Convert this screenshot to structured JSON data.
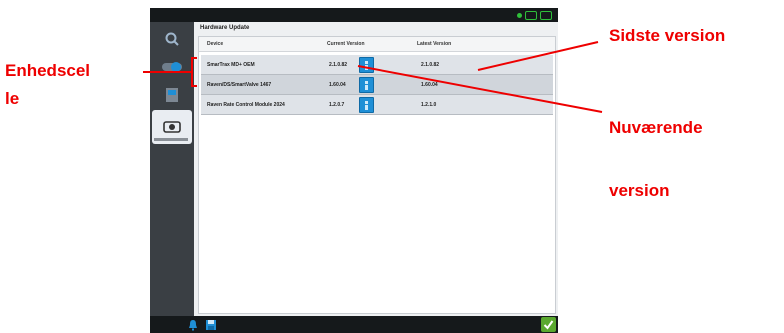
{
  "screen": {
    "title": "Hardware Update",
    "columns": {
      "device": "Device",
      "current": "Current Version",
      "latest": "Latest Version"
    },
    "rows": [
      {
        "device": "SmarTrax MD+ OEM",
        "current": "2.1.0.82",
        "latest": "2.1.0.82"
      },
      {
        "device": "Raven/DS/SmartValve 1467",
        "current": "1.60.04",
        "latest": "1.60.04"
      },
      {
        "device": "Raven Rate Control Module 2024",
        "current": "1.2.0.7",
        "latest": "1.2.1.0"
      }
    ]
  },
  "annotations": {
    "device_column_line1": "Enhedscel",
    "device_column_line2": "le",
    "latest_version": "Sidste version",
    "current_version_line1": "Nuværende",
    "current_version_line2": "version"
  },
  "icons": {
    "sidebar": [
      "magnifier-icon",
      "toggle-icon",
      "box-icon",
      "gear-hardware-icon"
    ],
    "bottom": [
      "bell-icon",
      "save-icon",
      "checkmark-icon"
    ]
  },
  "colors": {
    "annotation": "#ee0000",
    "info_button": "#1f8fd6",
    "ok_button": "#5aa82f",
    "status_green": "#2fbf3a"
  }
}
